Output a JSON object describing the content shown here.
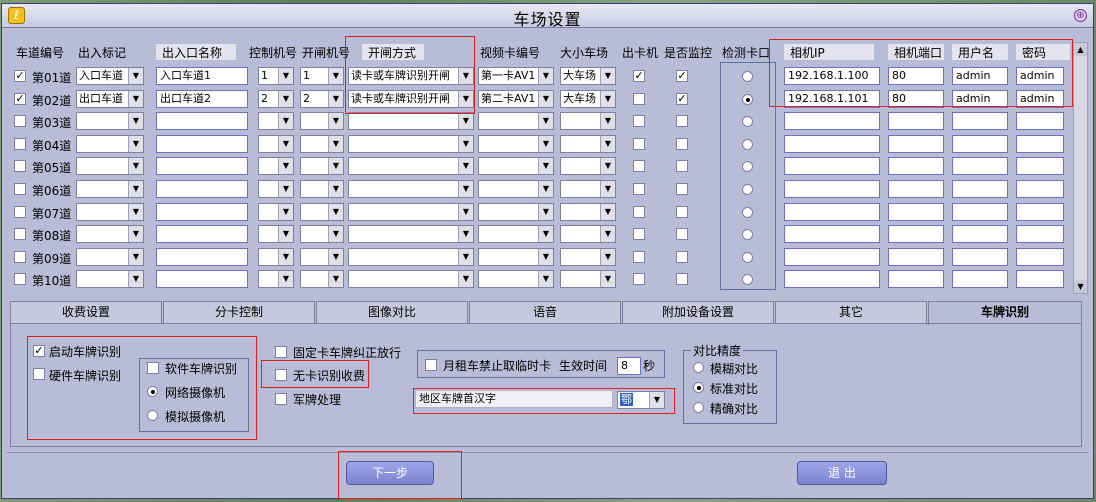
{
  "window": {
    "title": "车场设置",
    "close_symbol": "⊕",
    "app_icon": "ℓ"
  },
  "headers": {
    "lane_no": "车道编号",
    "io_flag": "出入标记",
    "io_name": "出入口名称",
    "ctrl_no": "控制机号",
    "gate_no": "开闸机号",
    "gate_mode": "开闸方式",
    "video_card": "视频卡编号",
    "lot_size": "大小车场",
    "ticket": "出卡机",
    "monitor": "是否监控",
    "detect": "检测卡口",
    "cam_ip": "相机IP",
    "cam_port": "相机端口",
    "user": "用户名",
    "pwd": "密码"
  },
  "rows": [
    {
      "checked": true,
      "lane": "第01道",
      "io_flag": "入口车道",
      "io_name": "入口车道1",
      "ctrl": "1",
      "gate": "1",
      "mode": "读卡或车牌识别开闸",
      "video": "第一卡AV1",
      "lot": "大车场",
      "ticket": true,
      "monitor": true,
      "detect": false,
      "ip": "192.168.1.100",
      "port": "80",
      "user": "admin",
      "pwd": "admin"
    },
    {
      "checked": true,
      "lane": "第02道",
      "io_flag": "出口车道",
      "io_name": "出口车道2",
      "ctrl": "2",
      "gate": "2",
      "mode": "读卡或车牌识别开闸",
      "video": "第二卡AV1",
      "lot": "大车场",
      "ticket": false,
      "monitor": true,
      "detect": true,
      "ip": "192.168.1.101",
      "port": "80",
      "user": "admin",
      "pwd": "admin"
    },
    {
      "checked": false,
      "lane": "第03道"
    },
    {
      "checked": false,
      "lane": "第04道"
    },
    {
      "checked": false,
      "lane": "第05道"
    },
    {
      "checked": false,
      "lane": "第06道"
    },
    {
      "checked": false,
      "lane": "第07道"
    },
    {
      "checked": false,
      "lane": "第08道"
    },
    {
      "checked": false,
      "lane": "第09道"
    },
    {
      "checked": false,
      "lane": "第10道"
    }
  ],
  "tabs": [
    "收费设置",
    "分卡控制",
    "图像对比",
    "语音",
    "附加设备设置",
    "其它",
    "车牌识别"
  ],
  "plate": {
    "enable": "启动车牌识别",
    "hardware": "硬件车牌识别",
    "software": "软件车牌识别",
    "net_cam": "网络摄像机",
    "analog_cam": "模拟摄像机",
    "fixed_card": "固定卡车牌纠正放行",
    "no_card": "无卡识别收费",
    "military": "军牌处理",
    "monthly": "月租车禁止取临时卡",
    "effective_time": "生效时间",
    "seconds_value": "8",
    "seconds_unit": "秒",
    "region_char": "地区车牌首汉字",
    "region_value": "鄂",
    "precision_title": "对比精度",
    "fuzzy": "模糊对比",
    "standard": "标准对比",
    "precise": "精确对比"
  },
  "buttons": {
    "next": "下一步",
    "exit": "退 出"
  }
}
